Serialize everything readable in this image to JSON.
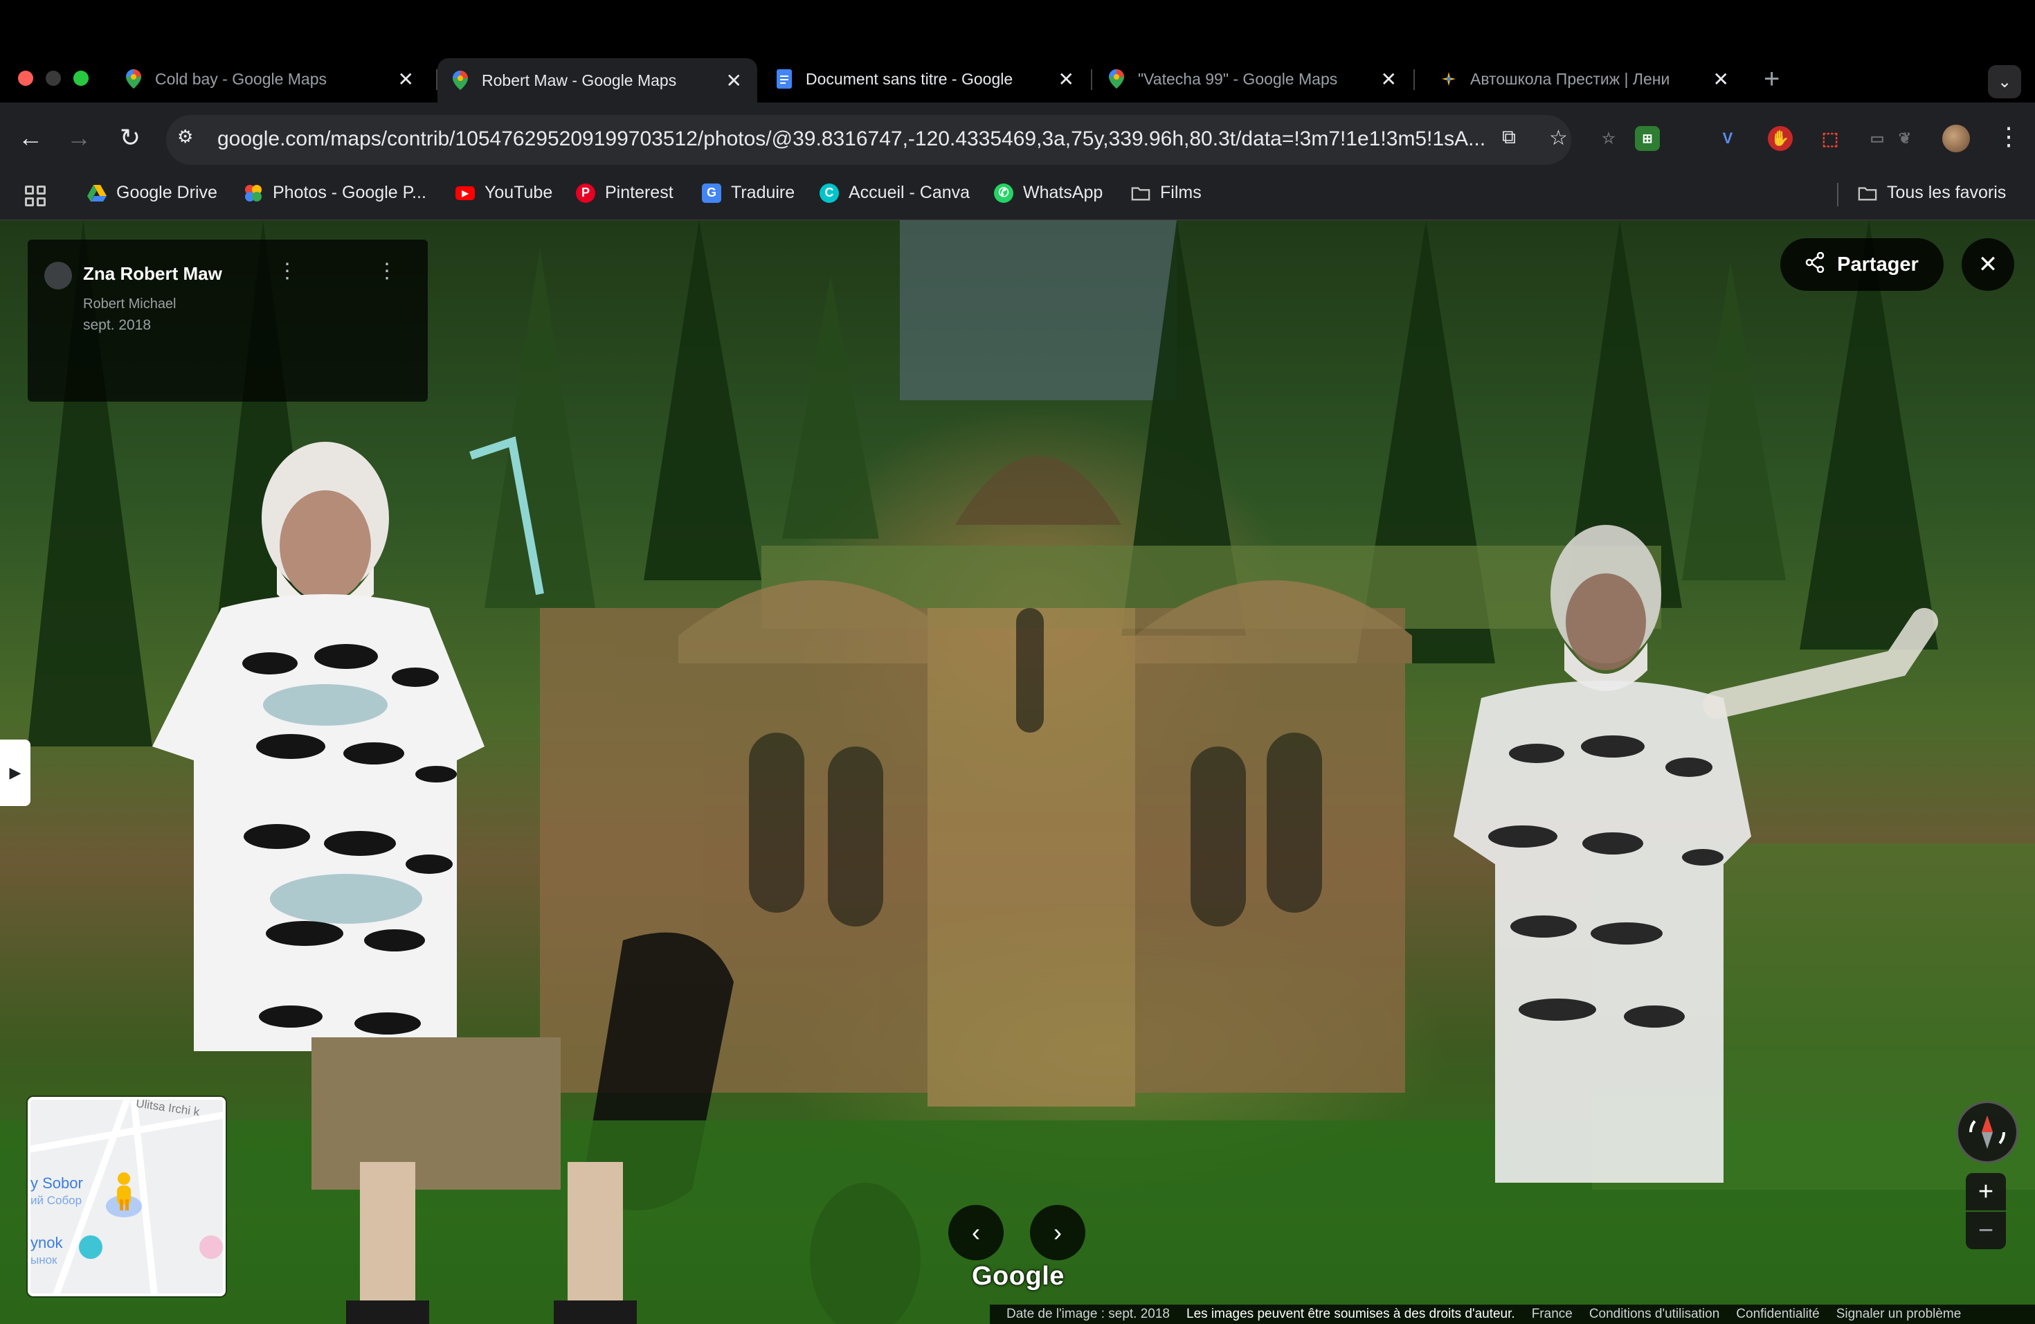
{
  "window": {
    "tabs": [
      {
        "title": "Cold bay - Google Maps",
        "active": false,
        "favicon": "google-maps-pin-icon"
      },
      {
        "title": "Robert Maw - Google Maps",
        "active": true,
        "favicon": "google-maps-pin-icon"
      },
      {
        "title": "Document sans titre - Google",
        "active": false,
        "favicon": "google-docs-icon"
      },
      {
        "title": "\"Vatecha 99\" - Google Maps",
        "active": false,
        "favicon": "google-maps-pin-icon"
      },
      {
        "title": "Автошкола Престиж | Лени",
        "active": false,
        "favicon": "autoschool-icon"
      }
    ],
    "close_glyph": "✕",
    "new_tab_glyph": "+",
    "tab_search_glyph": "⌄"
  },
  "toolbar": {
    "url": "google.com/maps/contrib/105476295209199703512/photos/@39.8316747,-120.4335469,3a,75y,339.96h,80.3t/data=!3m7!1e1!3m5!1sA..."
  },
  "bookmarks": [
    {
      "label": "Google Drive",
      "icon": "google-drive-icon"
    },
    {
      "label": "Photos - Google P...",
      "icon": "google-photos-icon"
    },
    {
      "label": "YouTube",
      "icon": "youtube-icon"
    },
    {
      "label": "Pinterest",
      "icon": "pinterest-icon"
    },
    {
      "label": "Traduire",
      "icon": "google-translate-icon"
    },
    {
      "label": "Accueil - Canva",
      "icon": "canva-icon"
    },
    {
      "label": "WhatsApp",
      "icon": "whatsapp-icon"
    },
    {
      "label": "Films",
      "icon": "folder-icon"
    }
  ],
  "all_bookmarks_label": "Tous les favoris",
  "viewer": {
    "contributor_name": "Zna Robert Maw",
    "contributor_sub": "Robert Michael",
    "photo_date": "sept. 2018",
    "share_label": "Partager",
    "google_logo": "Google",
    "minimap": {
      "place_1": "y Sobor",
      "place_1_sub": "ий Собор",
      "place_2": "ynok",
      "place_2_sub": "ынок",
      "road": "Ulitsa Irchi k"
    },
    "footer": {
      "image_date": "Date de l'image : sept. 2018",
      "copyright": "Les images peuvent être soumises à des droits d'auteur.",
      "country": "France",
      "terms": "Conditions d'utilisation",
      "privacy": "Confidentialité",
      "report": "Signaler un problème"
    }
  },
  "colors": {
    "tab_active_bg": "#202124",
    "share_bg": "#000000",
    "accent_red": "#ea4335"
  }
}
